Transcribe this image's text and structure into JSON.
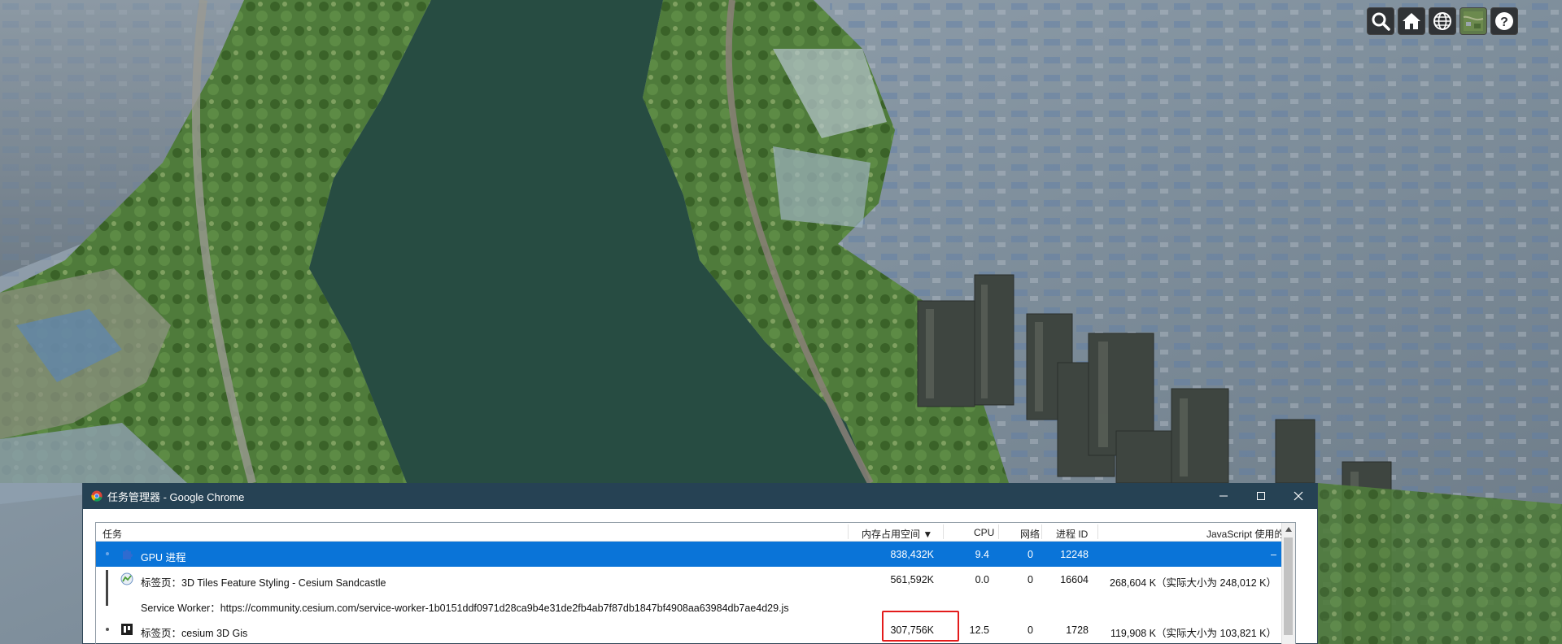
{
  "scene": {
    "description_hidden": ""
  },
  "toolbar": {
    "buttons": [
      {
        "name": "search-button",
        "icon": "search-icon"
      },
      {
        "name": "home-button",
        "icon": "home-icon"
      },
      {
        "name": "scene-mode-button",
        "icon": "globe-icon"
      },
      {
        "name": "base-layer-picker-button",
        "icon": "imagery-icon"
      },
      {
        "name": "help-button",
        "icon": "help-icon"
      }
    ]
  },
  "task_manager": {
    "title": "任务管理器 - Google Chrome",
    "columns": {
      "task": "任务",
      "memory": "内存占用空间 ▼",
      "cpu": "CPU",
      "network": "网络",
      "pid": "进程 ID",
      "js_memory": "JavaScript 使用的内存"
    },
    "rows": [
      {
        "task": "GPU 进程",
        "memory": "838,432K",
        "cpu": "9.4",
        "network": "0",
        "pid": "12248",
        "js_memory": "–",
        "selected": true
      },
      {
        "task": "标签页：3D Tiles Feature Styling - Cesium Sandcastle",
        "memory": "561,592K",
        "cpu": "0.0",
        "network": "0",
        "pid": "16604",
        "js_memory": "268,604 K（实际大小为 248,012 K）"
      },
      {
        "task": "Service Worker：https://community.cesium.com/service-worker-1b0151ddf0971d28ca9b4e31de2fb4ab7f87db1847bf4908aa63984db7ae4d29.js"
      },
      {
        "task": "标签页：cesium 3D Gis",
        "memory": "307,756K",
        "cpu": "12.5",
        "network": "0",
        "pid": "1728",
        "js_memory": "119,908 K（实际大小为 103,821 K）"
      }
    ]
  },
  "colors": {
    "titlebar": "#264254",
    "selection": "#0a74d8",
    "highlight_box": "#e31b1b",
    "river": "#2b5247"
  }
}
